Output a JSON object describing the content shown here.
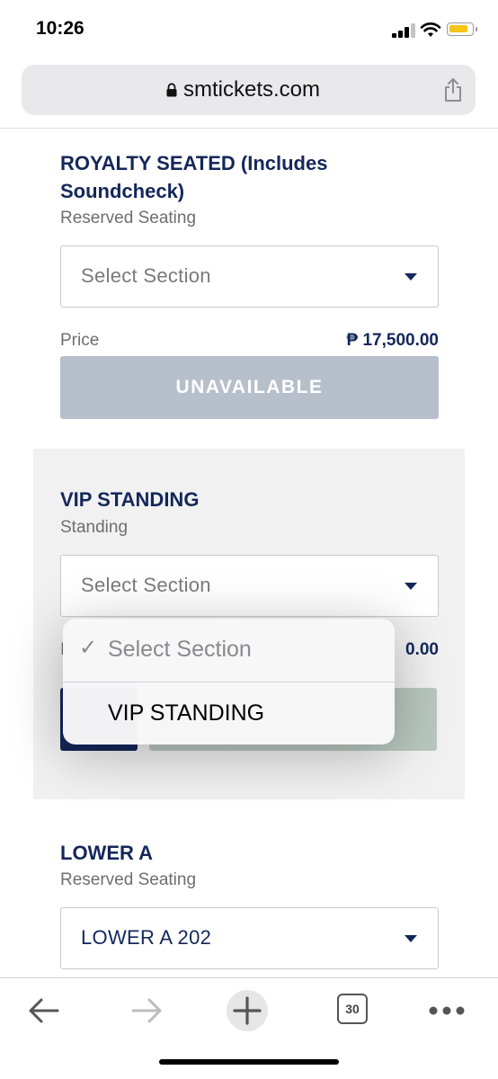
{
  "status_bar": {
    "time": "10:26"
  },
  "browser": {
    "url": "smtickets.com",
    "tabs_count": "30"
  },
  "sections": [
    {
      "title_line1": "ROYALTY SEATED (Includes",
      "title_line2": "Soundcheck)",
      "subtitle": "Reserved Seating",
      "select_placeholder": "Select Section",
      "price_label": "Price",
      "price_value": "₱ 17,500.00",
      "button_label": "UNAVAILABLE"
    },
    {
      "title": "VIP STANDING",
      "subtitle": "Standing",
      "select_placeholder": "Select Section",
      "price_label_partial": "I",
      "price_value_partial": "0.00"
    },
    {
      "title": "LOWER A",
      "subtitle": "Reserved Seating",
      "select_value": "LOWER A 202"
    }
  ],
  "dropdown": {
    "selected_mark": "✓",
    "options": [
      "Select Section",
      "VIP STANDING"
    ]
  }
}
